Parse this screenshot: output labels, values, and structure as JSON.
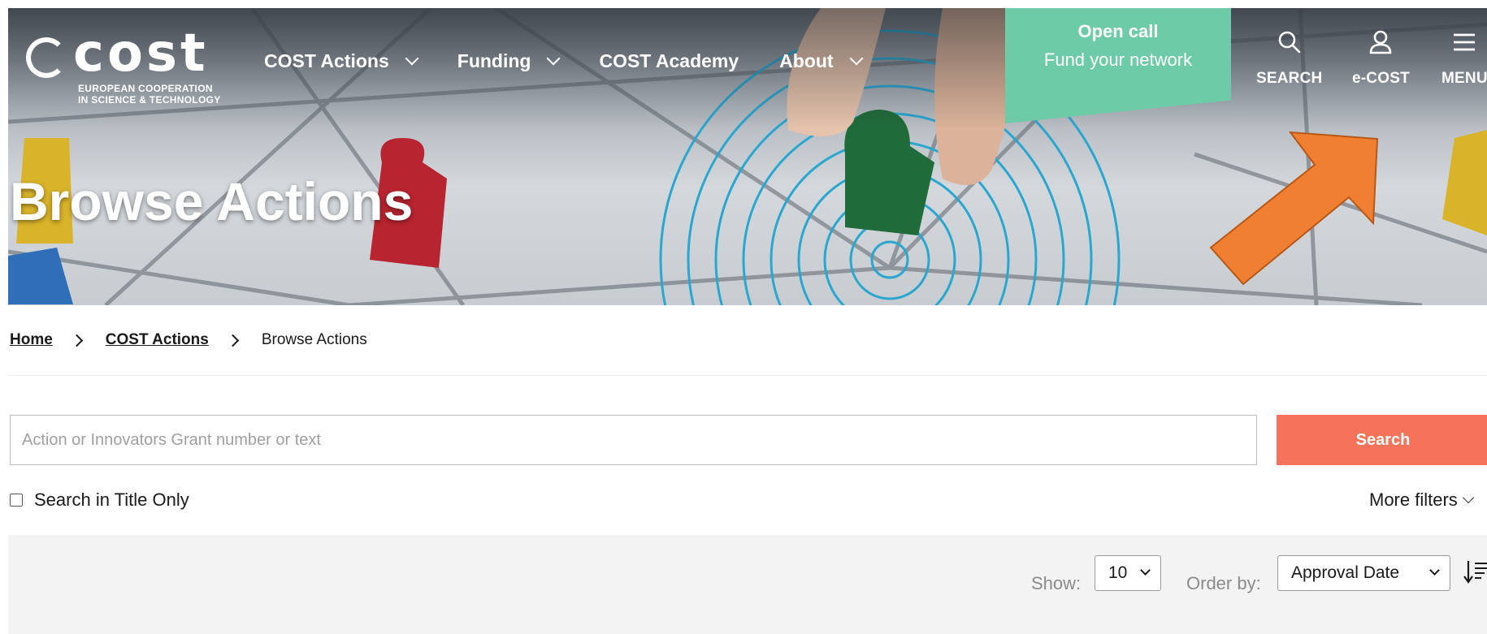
{
  "brand": {
    "logo_word": "cost",
    "logo_sub_line1": "EUROPEAN COOPERATION",
    "logo_sub_line2": "IN SCIENCE & TECHNOLOGY"
  },
  "nav": {
    "items": [
      {
        "label": "COST Actions",
        "has_dropdown": true
      },
      {
        "label": "Funding",
        "has_dropdown": true
      },
      {
        "label": "COST Academy",
        "has_dropdown": false
      },
      {
        "label": "About",
        "has_dropdown": true
      }
    ]
  },
  "open_call": {
    "title": "Open call",
    "subtitle": "Fund your network",
    "color": "#6ecba7"
  },
  "utility": {
    "search_label": "SEARCH",
    "ecost_label": "e-COST",
    "menu_label": "MENU",
    "icons": [
      "search-icon",
      "user-icon",
      "menu-icon"
    ]
  },
  "hero": {
    "title": "Browse Actions"
  },
  "breadcrumb": {
    "home": "Home",
    "section": "COST Actions",
    "current": "Browse Actions"
  },
  "search": {
    "placeholder": "Action or Innovators Grant number or text",
    "value": "",
    "button_label": "Search",
    "button_color": "#f4735a",
    "title_only_label": "Search in Title Only",
    "title_only_checked": false,
    "more_filters_label": "More filters"
  },
  "list_controls": {
    "show_label": "Show:",
    "show_value": "10",
    "order_label": "Order by:",
    "order_value": "Approval Date",
    "sort_icon": "sort-descending-icon"
  },
  "annotation": {
    "arrow_color": "#f07f31",
    "points_to": "e-COST"
  }
}
